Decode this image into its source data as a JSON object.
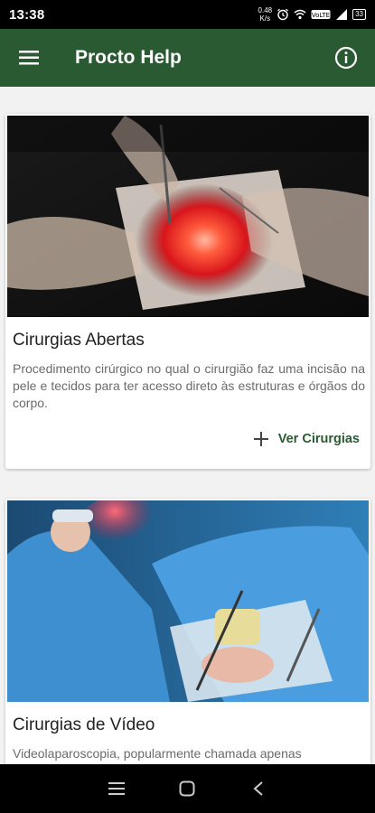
{
  "status_bar": {
    "time": "13:38",
    "net_speed_value": "0.48",
    "net_speed_unit": "K/s",
    "battery": "33"
  },
  "app_bar": {
    "title": "Procto Help"
  },
  "cards": [
    {
      "title": "Cirurgias Abertas",
      "description": "Procedimento cirúrgico no qual o cirurgião faz uma incisão na pele e tecidos para ter acesso direto às estruturas e órgãos do corpo.",
      "action_label": "Ver Cirurgias"
    },
    {
      "title": "Cirurgias de Vídeo",
      "description": "Videolaparoscopia, popularmente chamada apenas"
    }
  ],
  "colors": {
    "primary": "#2a5a32",
    "background": "#f2f2f2"
  }
}
